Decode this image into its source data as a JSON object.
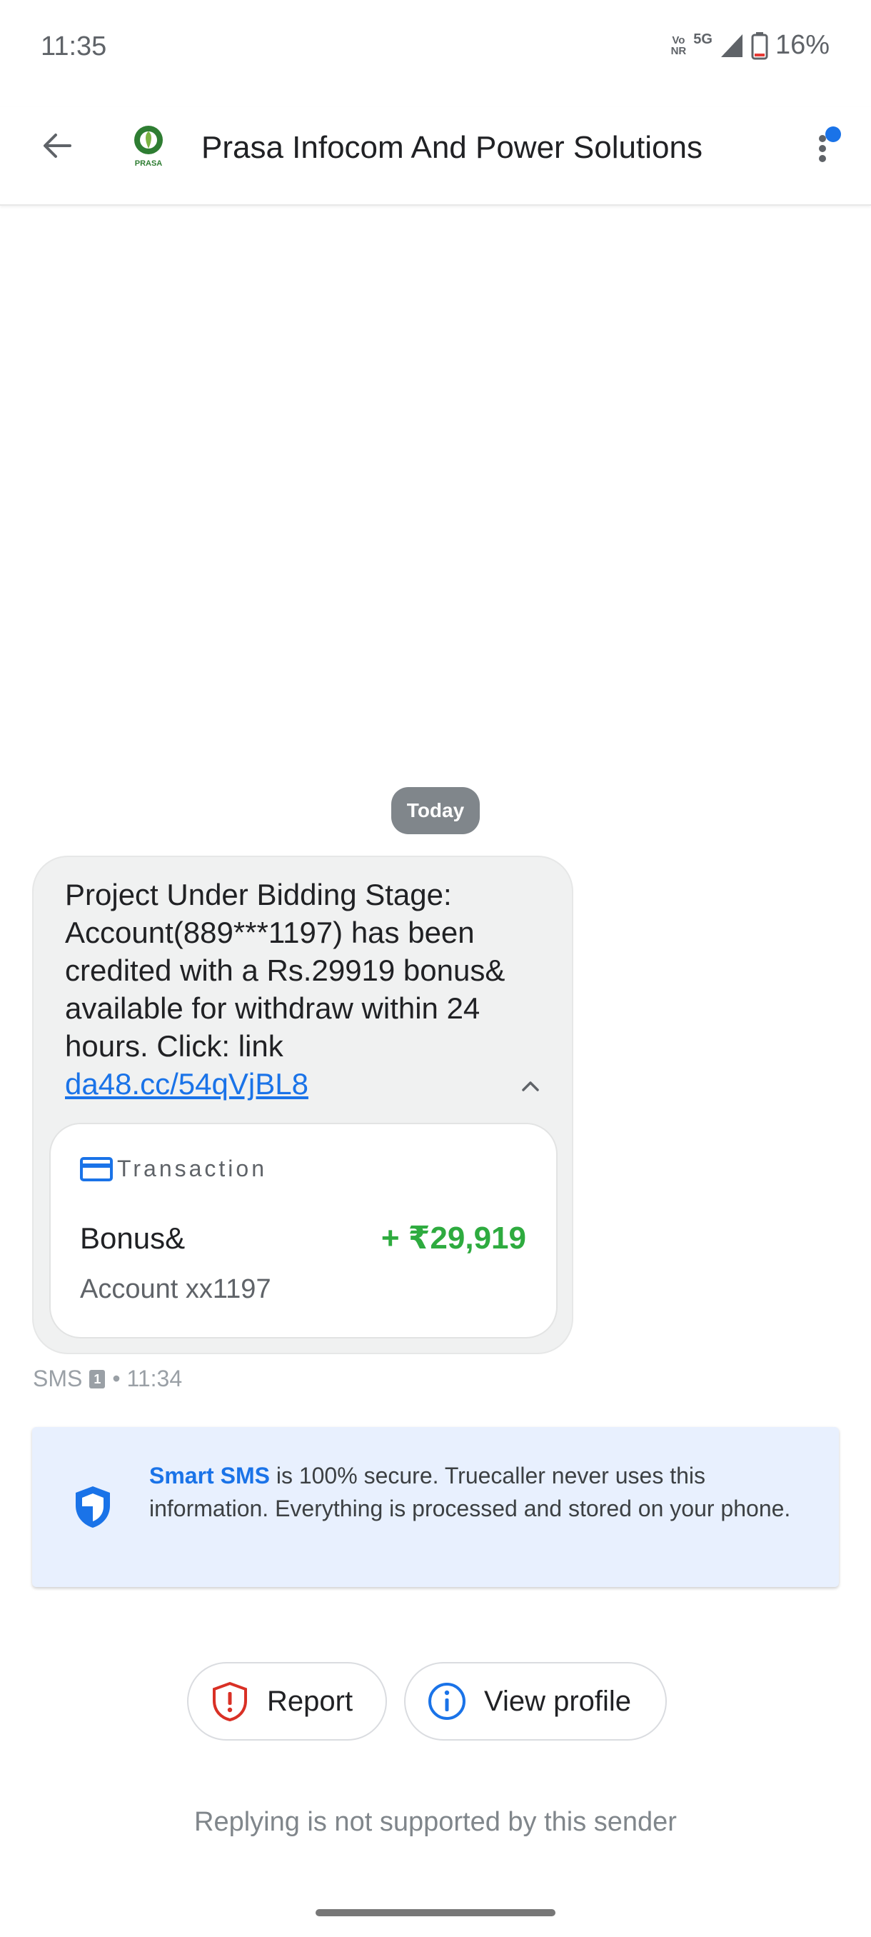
{
  "status_bar": {
    "time": "11:35",
    "volte_top": "Vo",
    "volte_bottom": "NR",
    "network": "5G",
    "battery": "16%",
    "battery_level": 0.16,
    "icons": [
      "signal-icon",
      "battery-icon"
    ]
  },
  "header": {
    "sender": "Prasa Infocom And Power Solutions",
    "logo_text": "PRASA",
    "icons": [
      "back-arrow-icon",
      "more-options-icon"
    ]
  },
  "conversation": {
    "date_chip": "Today",
    "message": {
      "text": "Project Under Bidding Stage: Account(889***1197) has been credited with a Rs.29919 bonus& available for withdraw within 24 hours. Click: link",
      "link": "da48.cc/54qVjBL8",
      "transaction": {
        "title": "Transaction",
        "name": "Bonus&",
        "amount": "+ ₹29,919",
        "account": "Account xx1197",
        "amount_color": "#2eab3f"
      },
      "meta_type": "SMS",
      "sim": "1",
      "meta_time": "• 11:34"
    }
  },
  "info_card": {
    "highlight": "Smart SMS",
    "text": " is 100% secure. Truecaller never uses this information. Everything is processed and stored on your phone."
  },
  "actions": {
    "report": "Report",
    "view_profile": "View profile"
  },
  "footer": {
    "reply_note": "Replying is not supported by this sender"
  },
  "colors": {
    "accent": "#1a73e8",
    "report_red": "#d93025",
    "notification_dot": "#1a73e8"
  }
}
